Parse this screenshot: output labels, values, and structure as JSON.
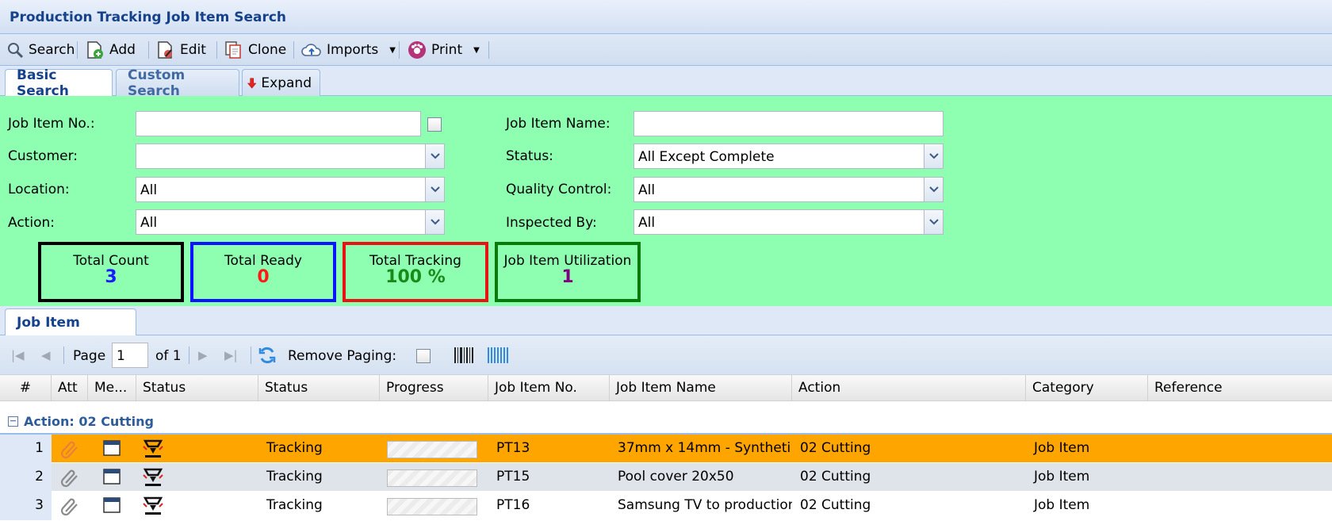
{
  "title": "Production Tracking Job Item Search",
  "toolbar": {
    "search": "Search",
    "add": "Add",
    "edit": "Edit",
    "clone": "Clone",
    "imports": "Imports",
    "print": "Print"
  },
  "tabs": {
    "basic": "Basic Search",
    "custom": "Custom Search",
    "expand": "Expand"
  },
  "form": {
    "job_item_no_label": "Job Item No.:",
    "job_item_no_value": "",
    "job_item_name_label": "Job Item Name:",
    "job_item_name_value": "",
    "customer_label": "Customer:",
    "customer_value": "",
    "status_label": "Status:",
    "status_value": "All Except Complete",
    "location_label": "Location:",
    "location_value": "All",
    "quality_label": "Quality Control:",
    "quality_value": "All",
    "action_label": "Action:",
    "action_value": "All",
    "inspected_label": "Inspected By:",
    "inspected_value": "All"
  },
  "stats": {
    "total_count_label": "Total Count",
    "total_count": "3",
    "total_ready_label": "Total Ready",
    "total_ready": "0",
    "total_tracking_label": "Total Tracking",
    "total_tracking": "100 %",
    "utilization_label": "Job Item Utilization",
    "utilization": "1"
  },
  "grid_tab": "Job Item",
  "pager": {
    "page_label": "Page",
    "page_value": "1",
    "of_label": "of 1",
    "remove_paging": "Remove Paging:"
  },
  "columns": {
    "num": "#",
    "att": "Att",
    "memo": "Me...",
    "status_icon": "Status",
    "status": "Status",
    "progress": "Progress",
    "job_item_no": "Job Item No.",
    "job_item_name": "Job Item Name",
    "action": "Action",
    "category": "Category",
    "reference": "Reference"
  },
  "group_label": "Action: 02 Cutting",
  "rows": [
    {
      "num": "1",
      "status": "Tracking",
      "job_item_no": "PT13",
      "job_item_name": "37mm x 14mm - Syntheti...",
      "action": "02 Cutting",
      "category": "Job Item",
      "reference": ""
    },
    {
      "num": "2",
      "status": "Tracking",
      "job_item_no": "PT15",
      "job_item_name": "Pool cover 20x50",
      "action": "02 Cutting",
      "category": "Job Item",
      "reference": ""
    },
    {
      "num": "3",
      "status": "Tracking",
      "job_item_no": "PT16",
      "job_item_name": "Samsung TV to production",
      "action": "02 Cutting",
      "category": "Job Item",
      "reference": ""
    }
  ],
  "colors": {
    "panel": "#8effb0",
    "selected_row": "#ffa500",
    "alt_row": "#dfe3ea",
    "count": "#1a1aff",
    "ready": "#ff1a1a",
    "tracking": "#1a8a1a",
    "utilization": "#800080"
  }
}
